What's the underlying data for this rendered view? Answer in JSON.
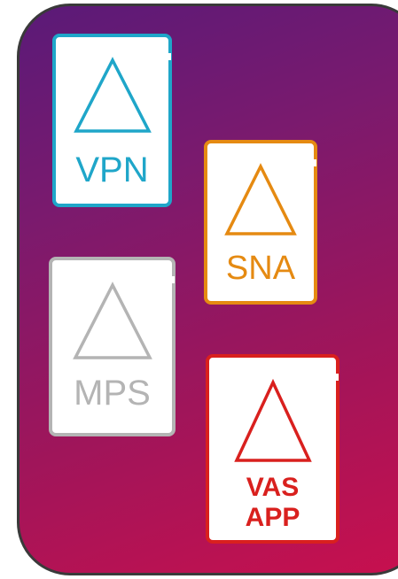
{
  "colors": {
    "vpn": "#1fa6c9",
    "sna": "#e58a12",
    "mps": "#b4b4b4",
    "vas": "#d9201e",
    "background_start": "#5a1a78",
    "background_end": "#c8104e"
  },
  "cards": {
    "vpn": {
      "label": "VPN",
      "icon": "warning-triangle-icon"
    },
    "sna": {
      "label": "SNA",
      "icon": "warning-triangle-icon"
    },
    "mps": {
      "label": "MPS",
      "icon": "warning-triangle-icon"
    },
    "vas": {
      "label_line1": "VAS",
      "label_line2": "APP",
      "icon": "warning-triangle-icon"
    }
  }
}
